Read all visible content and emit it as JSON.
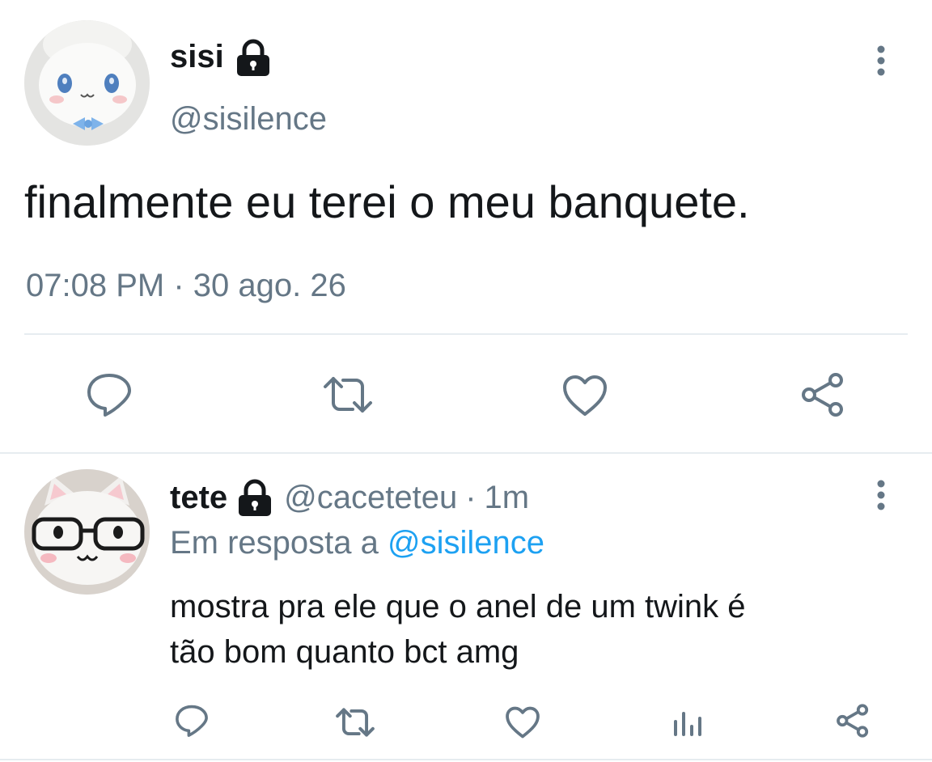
{
  "colors": {
    "text": "#14171a",
    "muted": "#657786",
    "icon": "#657786",
    "link": "#1da1f2",
    "divider": "#e6ecf0"
  },
  "main_tweet": {
    "display_name": "sisi",
    "handle": "@sisilence",
    "protected_icon": "lock-icon",
    "text": "finalmente eu terei o meu banquete.",
    "timestamp": "07:08 PM · 30 ago. 26",
    "actions": [
      "reply-icon",
      "retweet-icon",
      "like-icon",
      "share-icon"
    ]
  },
  "reply_tweet": {
    "display_name": "tete",
    "handle": "@caceteteu",
    "separator": "·",
    "time": "1m",
    "protected_icon": "lock-icon",
    "in_reply_prefix": "Em resposta a",
    "in_reply_handle": "@sisilence",
    "text_line1": "mostra pra ele que o anel de um twink é",
    "text_line2": "tão bom quanto bct amg",
    "actions": [
      "reply-icon",
      "retweet-icon",
      "like-icon",
      "analytics-icon",
      "share-icon"
    ]
  }
}
